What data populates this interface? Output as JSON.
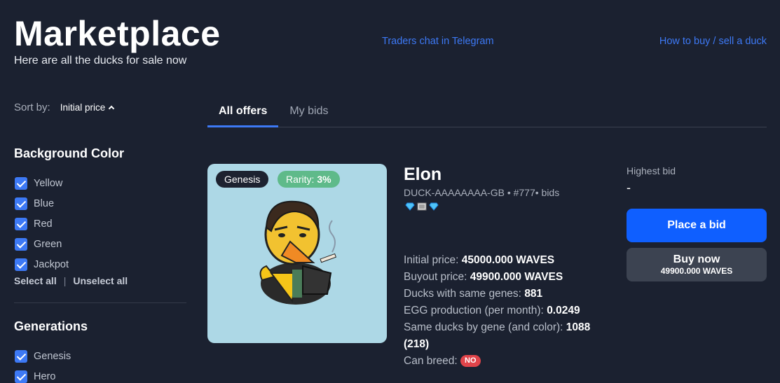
{
  "header": {
    "title": "Marketplace",
    "subtitle": "Here are all the ducks for sale now",
    "link_telegram": "Traders chat in Telegram",
    "link_howto": "How to buy / sell a duck"
  },
  "sidebar": {
    "sort_label": "Sort by:",
    "sort_value": "Initial price",
    "background_title": "Background Color",
    "background_items": [
      {
        "label": "Yellow",
        "checked": true
      },
      {
        "label": "Blue",
        "checked": true
      },
      {
        "label": "Red",
        "checked": true
      },
      {
        "label": "Green",
        "checked": true
      },
      {
        "label": "Jackpot",
        "checked": true
      }
    ],
    "select_all": "Select all",
    "separator": "|",
    "unselect_all": "Unselect all",
    "generations_title": "Generations",
    "generation_items": [
      {
        "label": "Genesis",
        "checked": true
      },
      {
        "label": "Hero",
        "checked": true
      }
    ]
  },
  "tabs": [
    {
      "label": "All offers",
      "active": true
    },
    {
      "label": "My bids",
      "active": false
    }
  ],
  "listing": {
    "badge_genesis": "Genesis",
    "rarity_label": "Rarity:",
    "rarity_value": "3%",
    "name": "Elon",
    "id_line": "DUCK-AAAAAAAA-GB • #777• bids",
    "gems": [
      "diamond-icon",
      "film-icon",
      "diamond-icon"
    ],
    "stats": {
      "initial_price_label": "Initial price:",
      "initial_price_value": "45000.000 WAVES",
      "buyout_price_label": "Buyout price:",
      "buyout_price_value": "49900.000 WAVES",
      "same_genes_label": "Ducks with same genes:",
      "same_genes_value": "881",
      "egg_label": "EGG production (per month):",
      "egg_value": "0.0249",
      "same_gene_color_label": "Same ducks by gene (and color):",
      "same_gene_color_value": "1088 (218)",
      "can_breed_label": "Can breed:",
      "can_breed_value": "NO"
    },
    "highest_bid_label": "Highest bid",
    "highest_bid_value": "-",
    "place_bid_label": "Place a bid",
    "buy_now_label": "Buy now",
    "buy_now_price": "49900.000 WAVES"
  },
  "colors": {
    "background": "#1b2130",
    "accent": "#3d79f5",
    "primary_button": "#0f5fff",
    "card_bg": "#add8e6",
    "rarity_badge": "#5fba8a",
    "no_badge": "#e0444a"
  }
}
